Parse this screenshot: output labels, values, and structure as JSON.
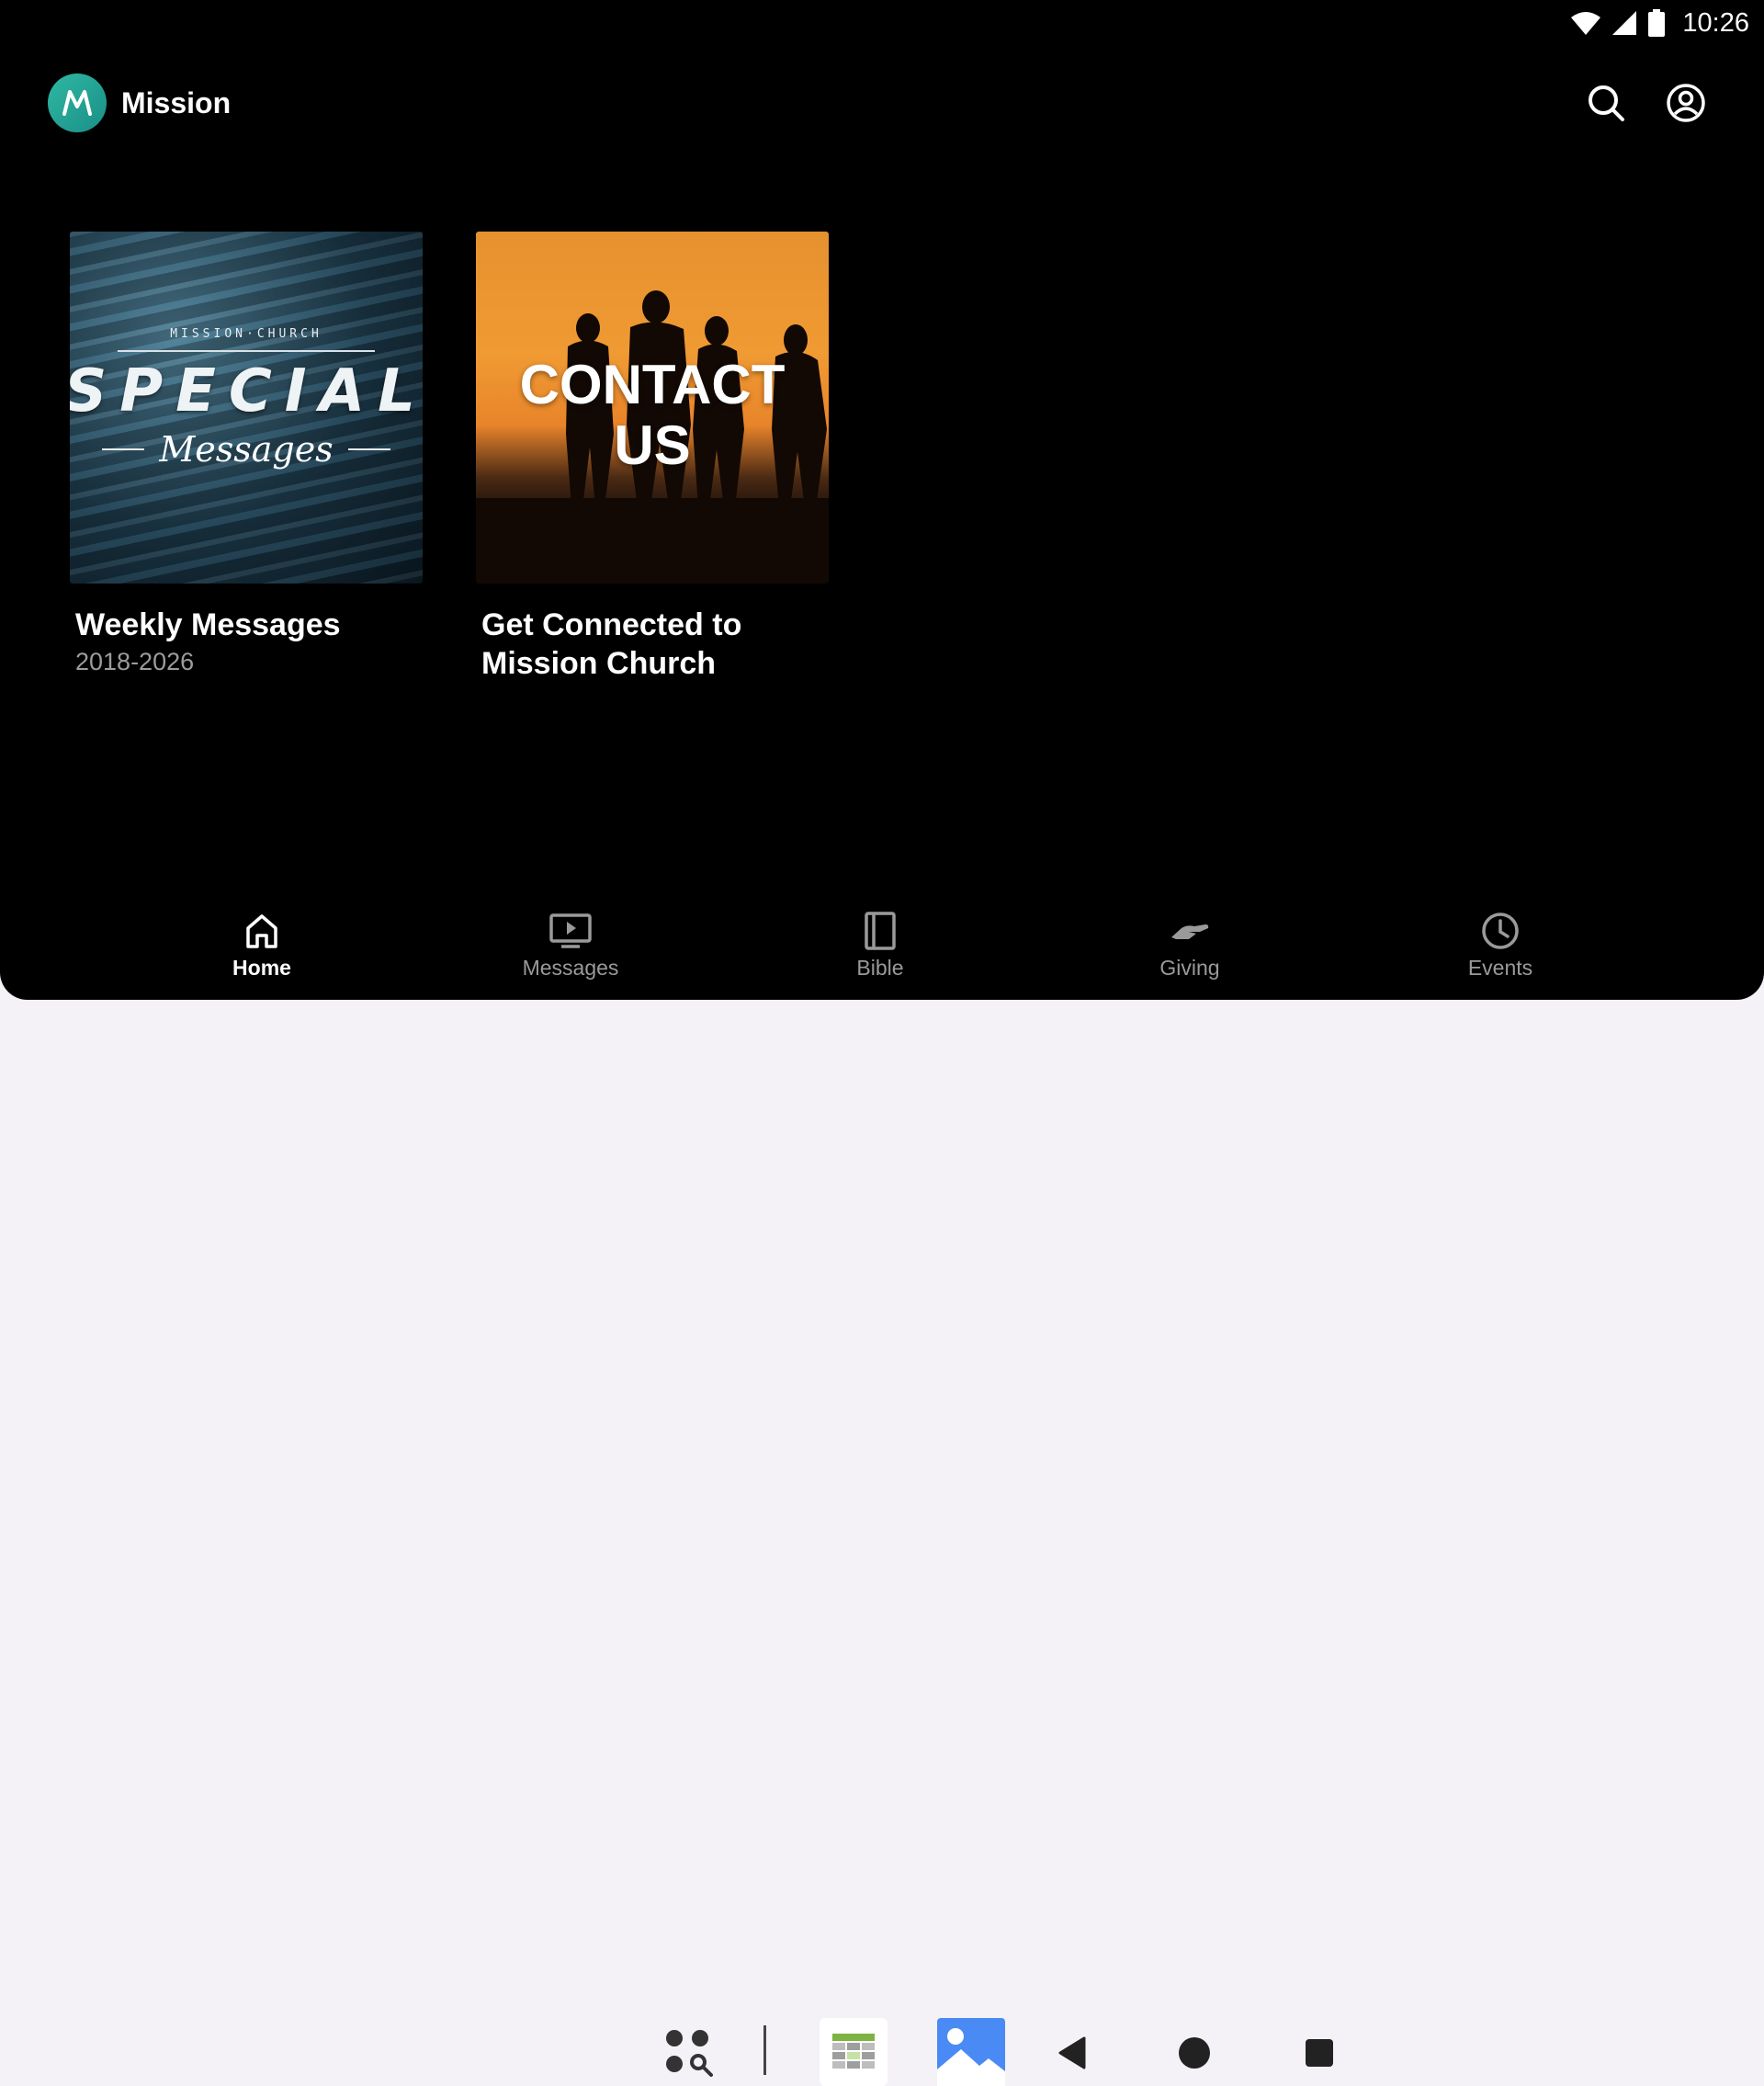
{
  "status_bar": {
    "time": "10:26"
  },
  "app_bar": {
    "title": "Mission"
  },
  "cards": [
    {
      "artwork": {
        "kicker": "MISSION·CHURCH",
        "main": "SPECIAL",
        "sub": "Messages"
      },
      "title": "Weekly Messages",
      "subtitle": "2018-2026"
    },
    {
      "artwork": {
        "main": "CONTACT US"
      },
      "title": "Get Connected to Mission Church",
      "subtitle": ""
    }
  ],
  "bottom_nav": {
    "items": [
      {
        "label": "Home",
        "icon": "home-icon",
        "active": true
      },
      {
        "label": "Messages",
        "icon": "tv-play-icon",
        "active": false
      },
      {
        "label": "Bible",
        "icon": "book-icon",
        "active": false
      },
      {
        "label": "Giving",
        "icon": "hand-giving-icon",
        "active": false
      },
      {
        "label": "Events",
        "icon": "clock-icon",
        "active": false
      }
    ]
  },
  "system_bar": {
    "icons": [
      "app-search-icon",
      "calendar-app-icon",
      "photos-app-icon",
      "back-icon",
      "home-circle-icon",
      "recents-icon"
    ]
  },
  "colors": {
    "background": "#000000",
    "logo_teal": "#2fb8a3",
    "inactive_label": "#9a9a9a",
    "subtitle": "#9c9c9c"
  }
}
